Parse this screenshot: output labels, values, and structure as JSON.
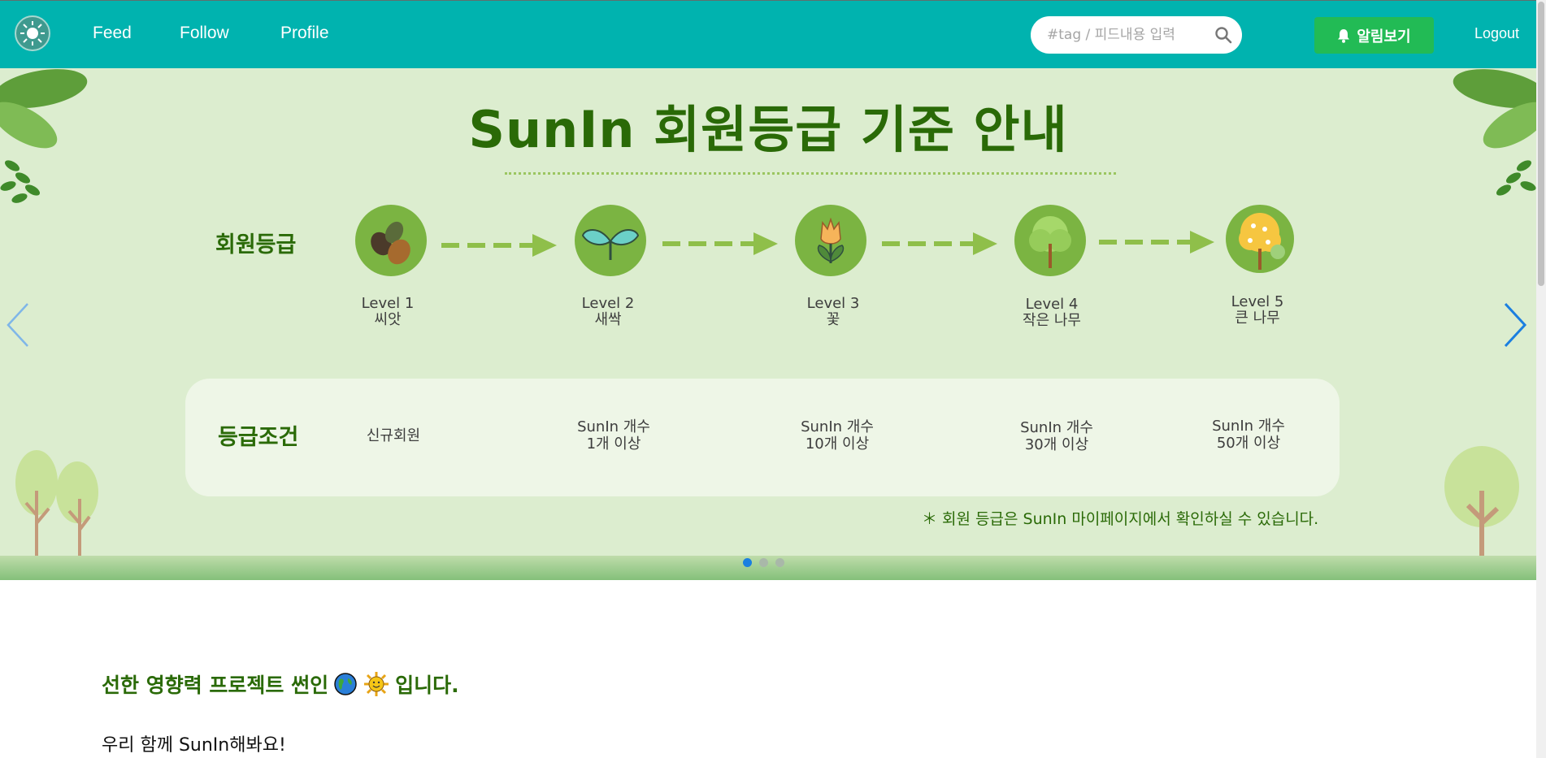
{
  "nav": {
    "links": [
      "Feed",
      "Follow",
      "Profile"
    ],
    "search_placeholder": "#tag / 피드내용 입력",
    "alarm_label": "알림보기",
    "logout_label": "Logout"
  },
  "banner": {
    "title": "SunIn 회원등급 기준 안내",
    "grade_label": "회원등급",
    "condition_label": "등급조건",
    "levels": [
      {
        "level": "Level 1",
        "name": "씨앗",
        "condition_line1": "신규회원",
        "condition_line2": ""
      },
      {
        "level": "Level 2",
        "name": "새싹",
        "condition_line1": "SunIn 개수",
        "condition_line2": "1개 이상"
      },
      {
        "level": "Level 3",
        "name": "꽃",
        "condition_line1": "SunIn 개수",
        "condition_line2": "10개 이상"
      },
      {
        "level": "Level 4",
        "name": "작은 나무",
        "condition_line1": "SunIn 개수",
        "condition_line2": "30개 이상"
      },
      {
        "level": "Level 5",
        "name": "큰 나무",
        "condition_line1": "SunIn 개수",
        "condition_line2": "50개 이상"
      }
    ],
    "note": "＊ 회원 등급은 SunIn 마이페이지에서 확인하실 수 있습니다.",
    "slide_count": 3,
    "active_slide": 1
  },
  "content": {
    "headline": "선한 영향력 프로젝트 썬인",
    "headline_suffix": "입니다.",
    "subtext": "우리 함께 SunIn해봐요!"
  },
  "colors": {
    "navbar": "#00b3af",
    "alarm_button": "#22bb55",
    "banner_bg": "#dcedcf",
    "title_green": "#2a6a07",
    "carousel_arrow": "#1b7fe0"
  }
}
